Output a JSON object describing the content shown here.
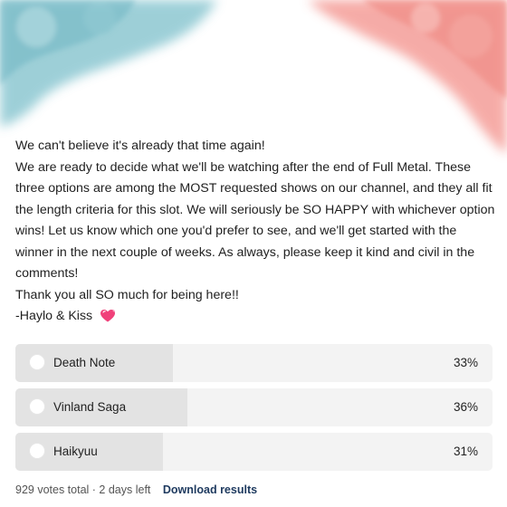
{
  "post": {
    "lines": [
      "We can't believe it's already that time again!",
      "We are ready to decide what we'll be watching after the end of Full Metal. These three options are among the MOST requested shows on our channel, and they all fit the length criteria for this slot. We will seriously be SO HAPPY with whichever option wins! Let us know which one you'd prefer to see, and we'll get started with the winner in the next couple of weeks. As always, please keep it kind and civil in the comments!",
      "Thank you all SO much for being here!!",
      "-Haylo & Kiss"
    ],
    "signature_emoji_icon": "sparkling-heart-icon"
  },
  "poll": {
    "options": [
      {
        "label": "Death Note",
        "percent_text": "33%",
        "percent": 33
      },
      {
        "label": "Vinland Saga",
        "percent_text": "36%",
        "percent": 36
      },
      {
        "label": "Haikyuu",
        "percent_text": "31%",
        "percent": 31
      }
    ],
    "footer": {
      "meta": "929 votes total · 2 days left",
      "download_label": "Download results"
    }
  },
  "colors": {
    "accent_blue": "#8cc7d1",
    "accent_pink": "#f2948f",
    "heart": "#f0417a",
    "link": "#1e3a5f"
  }
}
